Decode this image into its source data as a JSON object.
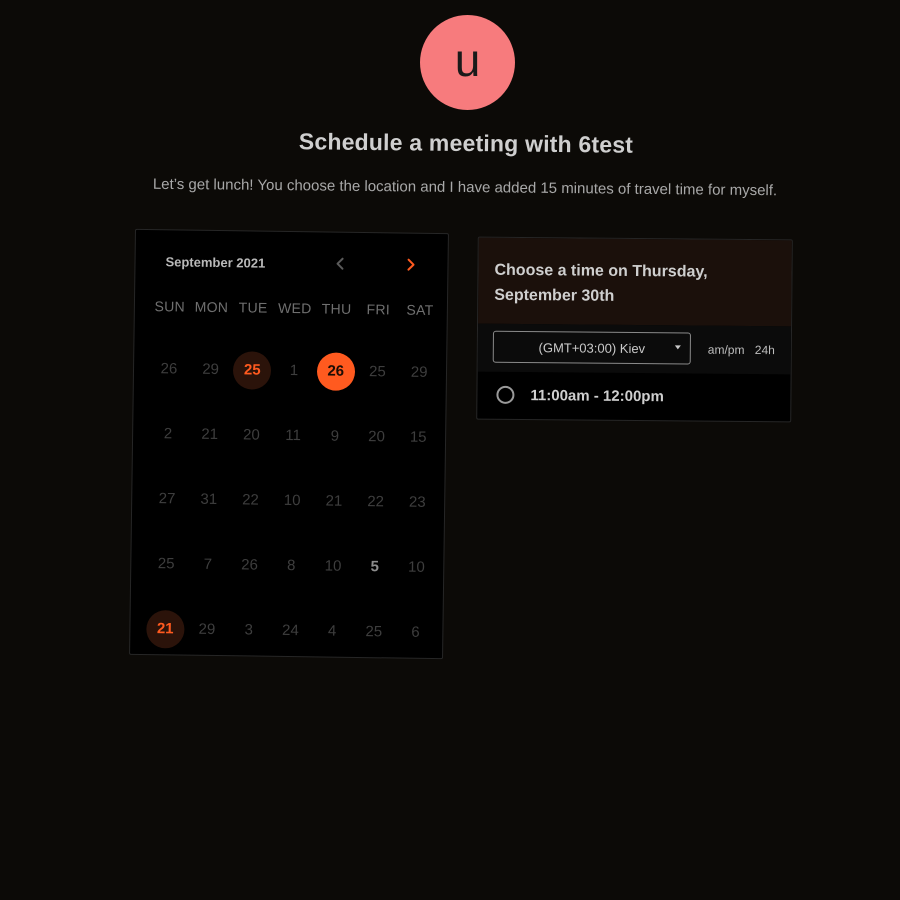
{
  "avatar": {
    "initial": "u",
    "color": "#f77b7d"
  },
  "title": "Schedule a meeting with 6test",
  "subtitle": "Let’s get lunch! You choose the location and I have added 15 minutes of travel time for myself.",
  "calendar": {
    "month_label": "September 2021",
    "prev_icon": "chevron-left-icon",
    "next_icon": "chevron-right-icon",
    "accent": "#ff5a1f",
    "weekdays": [
      "SUN",
      "MON",
      "TUE",
      "WED",
      "THU",
      "FRI",
      "SAT"
    ],
    "days": [
      {
        "n": "26"
      },
      {
        "n": "29"
      },
      {
        "n": "25",
        "state": "available"
      },
      {
        "n": "1"
      },
      {
        "n": "26",
        "state": "selected"
      },
      {
        "n": "25"
      },
      {
        "n": "29"
      },
      {
        "n": "2"
      },
      {
        "n": "21"
      },
      {
        "n": "20"
      },
      {
        "n": "11"
      },
      {
        "n": "9"
      },
      {
        "n": "20"
      },
      {
        "n": "15"
      },
      {
        "n": "27"
      },
      {
        "n": "31"
      },
      {
        "n": "22"
      },
      {
        "n": "10"
      },
      {
        "n": "21"
      },
      {
        "n": "22"
      },
      {
        "n": "23"
      },
      {
        "n": "25"
      },
      {
        "n": "7"
      },
      {
        "n": "26"
      },
      {
        "n": "8"
      },
      {
        "n": "10"
      },
      {
        "n": "5",
        "state": "strong"
      },
      {
        "n": "10"
      },
      {
        "n": "21",
        "state": "available"
      },
      {
        "n": "29"
      },
      {
        "n": "3"
      },
      {
        "n": "24"
      },
      {
        "n": "4"
      },
      {
        "n": "25"
      },
      {
        "n": "6"
      }
    ]
  },
  "time_panel": {
    "heading": "Choose a time on Thursday, September 30th",
    "timezone": "(GMT+03:00) Kiev",
    "format_ampm": "am/pm",
    "format_24h": "24h",
    "slots": [
      {
        "label": "11:00am - 12:00pm"
      }
    ]
  }
}
